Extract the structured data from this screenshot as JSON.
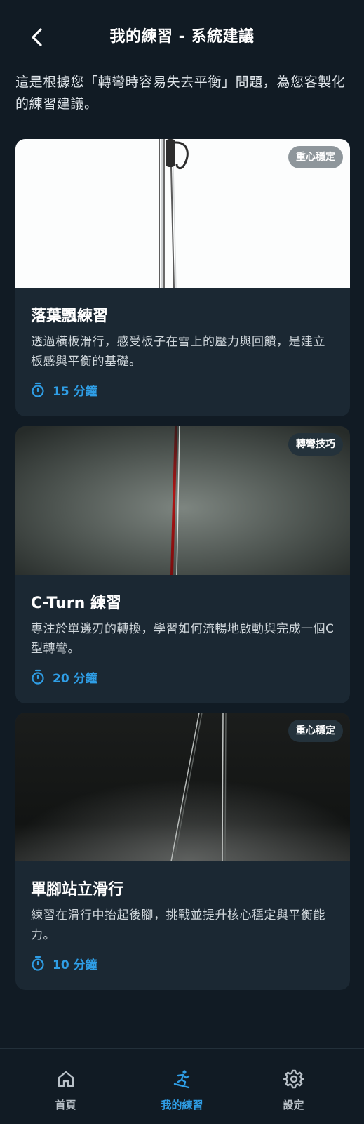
{
  "header": {
    "title": "我的練習 - 系統建議"
  },
  "intro": "這是根據您「轉彎時容易失去平衡」問題，為您客製化的練習建議。",
  "cards": [
    {
      "tag": "重心穩定",
      "title": "落葉飄練習",
      "description": "透過橫板滑行，感受板子在雪上的壓力與回饋，是建立板感與平衡的基礎。",
      "duration": "15 分鐘"
    },
    {
      "tag": "轉彎技巧",
      "title": "C-Turn 練習",
      "description": "專注於單邊刃的轉換，學習如何流暢地啟動與完成一個C型轉彎。",
      "duration": "20 分鐘"
    },
    {
      "tag": "重心穩定",
      "title": "單腳站立滑行",
      "description": "練習在滑行中抬起後腳，挑戰並提升核心穩定與平衡能力。",
      "duration": "10 分鐘"
    }
  ],
  "nav": [
    {
      "label": "首頁",
      "icon": "home-icon",
      "active": false
    },
    {
      "label": "我的練習",
      "icon": "snowboarder-icon",
      "active": true
    },
    {
      "label": "設定",
      "icon": "gear-icon",
      "active": false
    }
  ],
  "colors": {
    "background": "#111b24",
    "card": "#1b2833",
    "accent": "#2f9ee6",
    "badge_grey": "#8e969b",
    "badge_dark": "#24323b"
  }
}
